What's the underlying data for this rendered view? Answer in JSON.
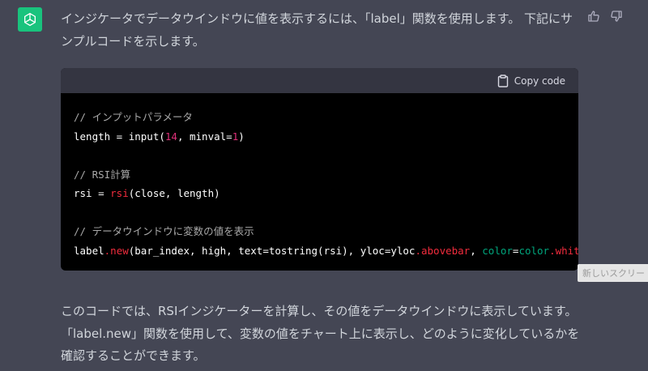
{
  "message": {
    "intro_text": "インジケータでデータウインドウに値を表示するには、「label」関数を使用します。 下記にサンプルコードを示します。",
    "outro_text": "このコードでは、RSIインジケーターを計算し、その値をデータウインドウに表示しています。「label.new」関数を使用して、変数の値をチャート上に表示し、どのように変化しているかを確認することができます。"
  },
  "code_block": {
    "copy_label": "Copy code",
    "lines": [
      {
        "segments": [
          {
            "text": "// インプットパラメータ",
            "cls": "cm"
          }
        ]
      },
      {
        "segments": [
          {
            "text": "length = input(",
            "cls": ""
          },
          {
            "text": "14",
            "cls": "nm"
          },
          {
            "text": ", minval=",
            "cls": ""
          },
          {
            "text": "1",
            "cls": "nm"
          },
          {
            "text": ")",
            "cls": ""
          }
        ]
      },
      {
        "segments": []
      },
      {
        "segments": [
          {
            "text": "// RSI計算",
            "cls": "cm"
          }
        ]
      },
      {
        "segments": [
          {
            "text": "rsi = ",
            "cls": ""
          },
          {
            "text": "rsi",
            "cls": "fn"
          },
          {
            "text": "(close, length)",
            "cls": ""
          }
        ]
      },
      {
        "segments": []
      },
      {
        "segments": [
          {
            "text": "// データウインドウに変数の値を表示",
            "cls": "cm"
          }
        ]
      },
      {
        "segments": [
          {
            "text": "label",
            "cls": ""
          },
          {
            "text": ".new",
            "cls": "fn"
          },
          {
            "text": "(bar_index, high, text=tostring(rsi), yloc=yloc",
            "cls": ""
          },
          {
            "text": ".abovebar",
            "cls": "fn"
          },
          {
            "text": ", ",
            "cls": ""
          },
          {
            "text": "color",
            "cls": "gr"
          },
          {
            "text": "=",
            "cls": ""
          },
          {
            "text": "color",
            "cls": "gr"
          },
          {
            "text": ".white",
            "cls": "fn"
          },
          {
            "text": ")",
            "cls": ""
          }
        ]
      }
    ]
  },
  "tooltip": {
    "text": "新しいスクリー"
  },
  "icons": {
    "avatar": "openai-logo-icon",
    "thumbs_up": "thumbs-up-icon",
    "thumbs_down": "thumbs-down-icon",
    "copy": "clipboard-icon"
  },
  "colors": {
    "background": "#444654",
    "avatar_bg": "#19c37d",
    "code_bg": "#000000",
    "code_header_bg": "#343541",
    "comment": "#a9a9a9",
    "number": "#df3079",
    "function": "#f22c3d",
    "keyword": "#00a67d"
  }
}
